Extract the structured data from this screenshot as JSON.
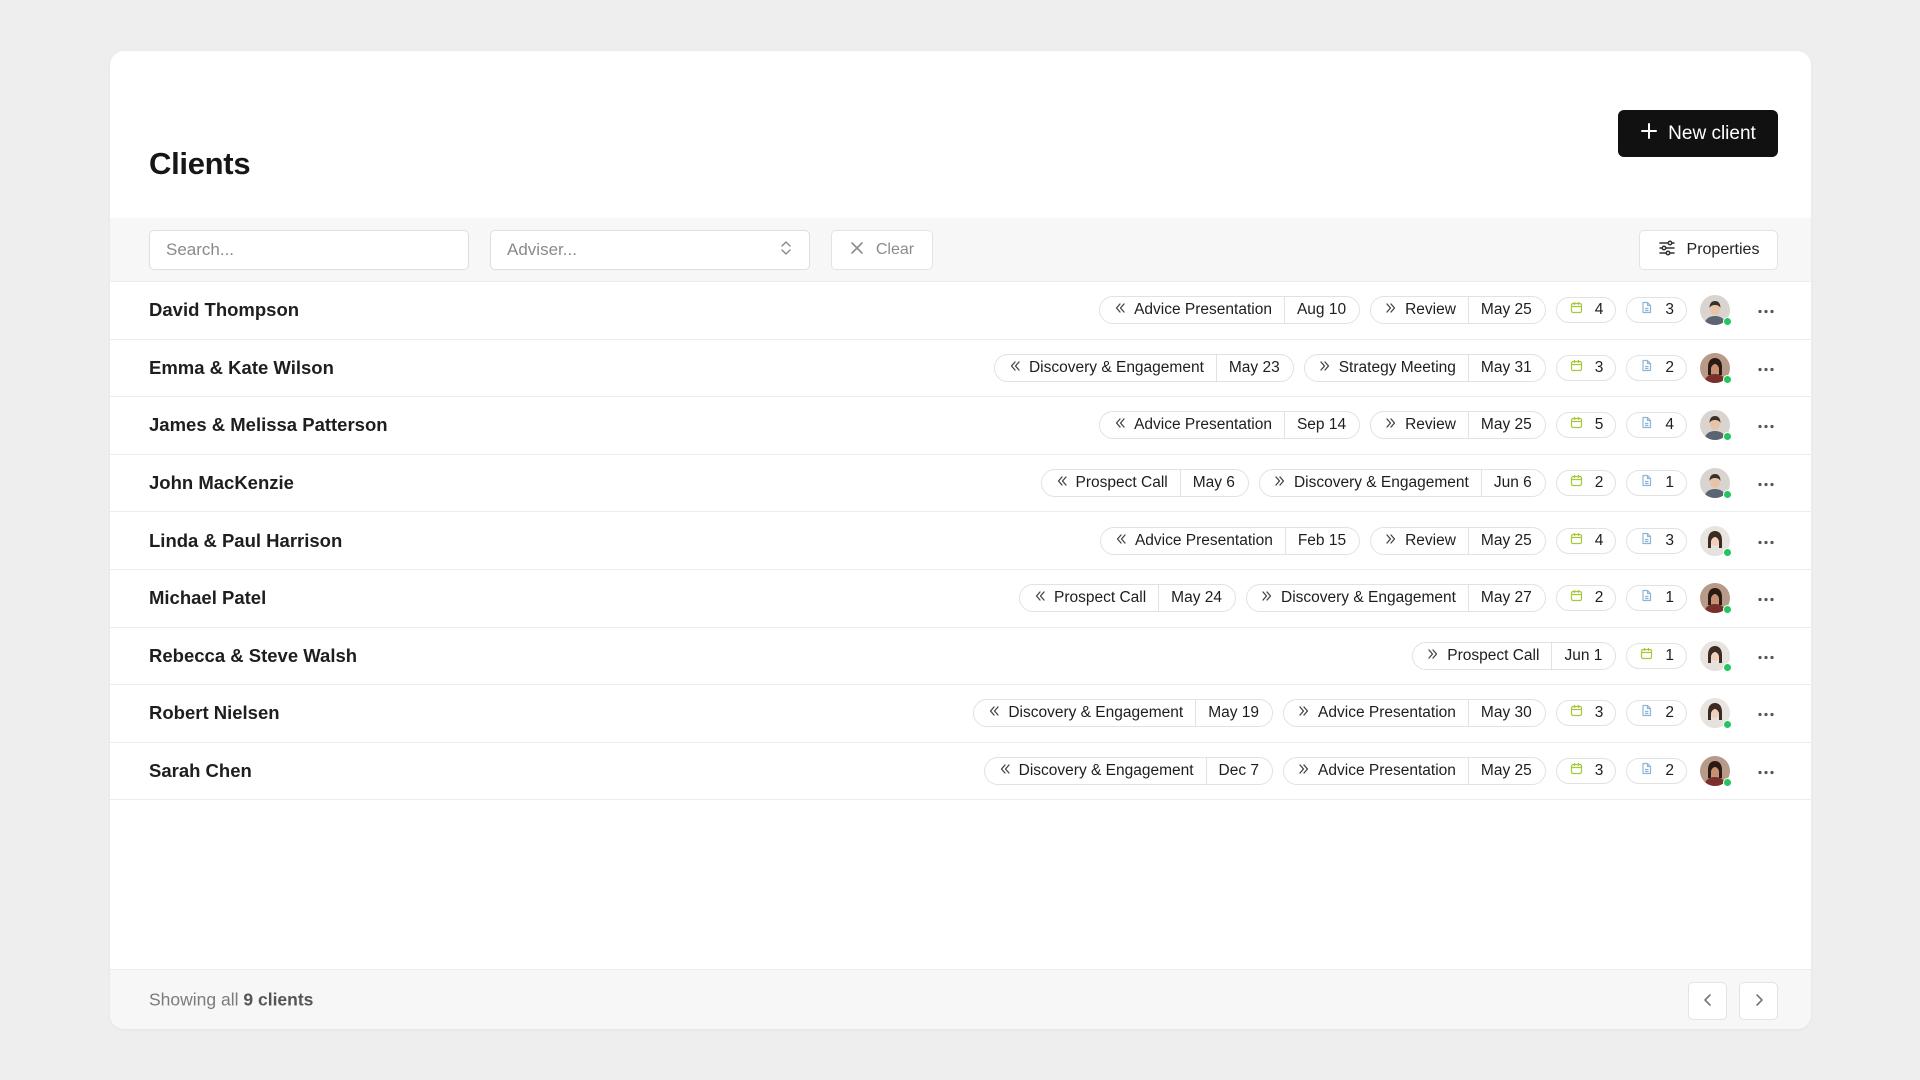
{
  "header": {
    "title": "Clients",
    "new_client_label": "New client"
  },
  "toolbar": {
    "search_placeholder": "Search...",
    "adviser_placeholder": "Adviser...",
    "clear_label": "Clear",
    "properties_label": "Properties"
  },
  "colors": {
    "calendar_icon": "#a6c93a",
    "document_icon": "#8fb5d6",
    "online": "#22c55e",
    "primary_button": "#111111"
  },
  "clients": [
    {
      "name": "David Thompson",
      "prev_stage": "Advice Presentation",
      "prev_date": "Aug 10",
      "next_stage": "Review",
      "next_date": "May 25",
      "meetings": "4",
      "documents": "3",
      "avatar": "male-light"
    },
    {
      "name": "Emma & Kate Wilson",
      "prev_stage": "Discovery & Engagement",
      "prev_date": "May 23",
      "next_stage": "Strategy Meeting",
      "next_date": "May 31",
      "meetings": "3",
      "documents": "2",
      "avatar": "female-dark"
    },
    {
      "name": "James & Melissa Patterson",
      "prev_stage": "Advice Presentation",
      "prev_date": "Sep 14",
      "next_stage": "Review",
      "next_date": "May 25",
      "meetings": "5",
      "documents": "4",
      "avatar": "male-light"
    },
    {
      "name": "John MacKenzie",
      "prev_stage": "Prospect Call",
      "prev_date": "May 6",
      "next_stage": "Discovery & Engagement",
      "next_date": "Jun 6",
      "meetings": "2",
      "documents": "1",
      "avatar": "male-light"
    },
    {
      "name": "Linda & Paul Harrison",
      "prev_stage": "Advice Presentation",
      "prev_date": "Feb 15",
      "next_stage": "Review",
      "next_date": "May 25",
      "meetings": "4",
      "documents": "3",
      "avatar": "female-light"
    },
    {
      "name": "Michael Patel",
      "prev_stage": "Prospect Call",
      "prev_date": "May 24",
      "next_stage": "Discovery & Engagement",
      "next_date": "May 27",
      "meetings": "2",
      "documents": "1",
      "avatar": "female-dark"
    },
    {
      "name": "Rebecca & Steve Walsh",
      "prev_stage": null,
      "prev_date": null,
      "next_stage": "Prospect Call",
      "next_date": "Jun 1",
      "meetings": "1",
      "documents": null,
      "avatar": "female-light"
    },
    {
      "name": "Robert Nielsen",
      "prev_stage": "Discovery & Engagement",
      "prev_date": "May 19",
      "next_stage": "Advice Presentation",
      "next_date": "May 30",
      "meetings": "3",
      "documents": "2",
      "avatar": "female-light"
    },
    {
      "name": "Sarah Chen",
      "prev_stage": "Discovery & Engagement",
      "prev_date": "Dec 7",
      "next_stage": "Advice Presentation",
      "next_date": "May 25",
      "meetings": "3",
      "documents": "2",
      "avatar": "female-dark"
    }
  ],
  "footer": {
    "prefix": "Showing all",
    "count_text": "9 clients"
  }
}
